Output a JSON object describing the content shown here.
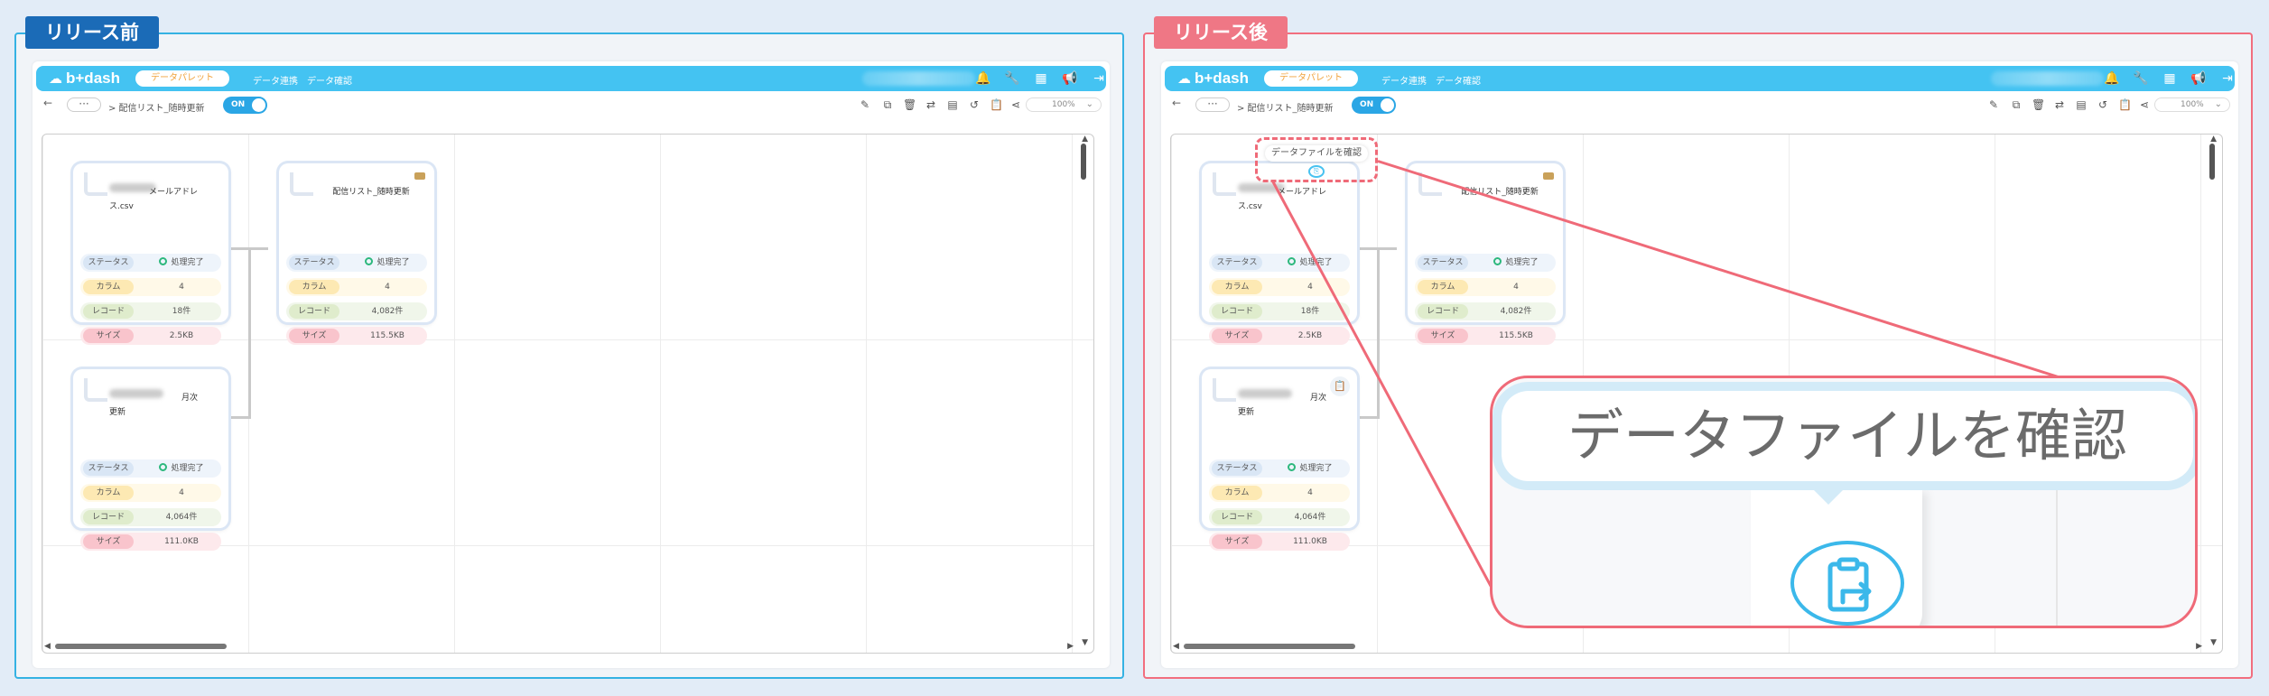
{
  "labels": {
    "before": "リリース前",
    "after": "リリース後"
  },
  "app": {
    "logo": "b+dash",
    "nav_pill": "データパレット",
    "nav_items": [
      "データ連携",
      "データ確認"
    ],
    "toolbar": {
      "back": "←",
      "dots": "···",
      "breadcrumb": "> 配信リスト_随時更新",
      "toggle": "ON",
      "zoom": "100%"
    }
  },
  "icons": {
    "navbar": [
      "bell-icon",
      "wrench-icon",
      "grid-icon",
      "megaphone-icon",
      "logout-icon"
    ],
    "toolbar": [
      "edit-icon",
      "copy-icon",
      "trash-icon",
      "swap-icon",
      "table-icon",
      "history-icon",
      "clipboard-icon",
      "share-icon"
    ]
  },
  "cards": [
    {
      "title": "メールアドレ",
      "sub": "ス.csv",
      "rows": [
        [
          "ステータス",
          "処理完了"
        ],
        [
          "カラム",
          "4"
        ],
        [
          "レコード",
          "18件"
        ],
        [
          "サイズ",
          "2.5KB"
        ]
      ]
    },
    {
      "title": "配信リスト_随時更新",
      "sub": "",
      "rows": [
        [
          "ステータス",
          "処理完了"
        ],
        [
          "カラム",
          "4"
        ],
        [
          "レコード",
          "4,082件"
        ],
        [
          "サイズ",
          "115.5KB"
        ]
      ]
    },
    {
      "title": "月次",
      "sub": "更新",
      "rows": [
        [
          "ステータス",
          "処理完了"
        ],
        [
          "カラム",
          "4"
        ],
        [
          "レコード",
          "4,064件"
        ],
        [
          "サイズ",
          "111.0KB"
        ]
      ]
    }
  ],
  "tooltip": {
    "text": "データファイルを確認"
  },
  "colors": {
    "accent_blue": "#44c3f2",
    "before_border": "#35b2e3",
    "after_border": "#f26e7e",
    "status_ok": "#2db87d"
  }
}
